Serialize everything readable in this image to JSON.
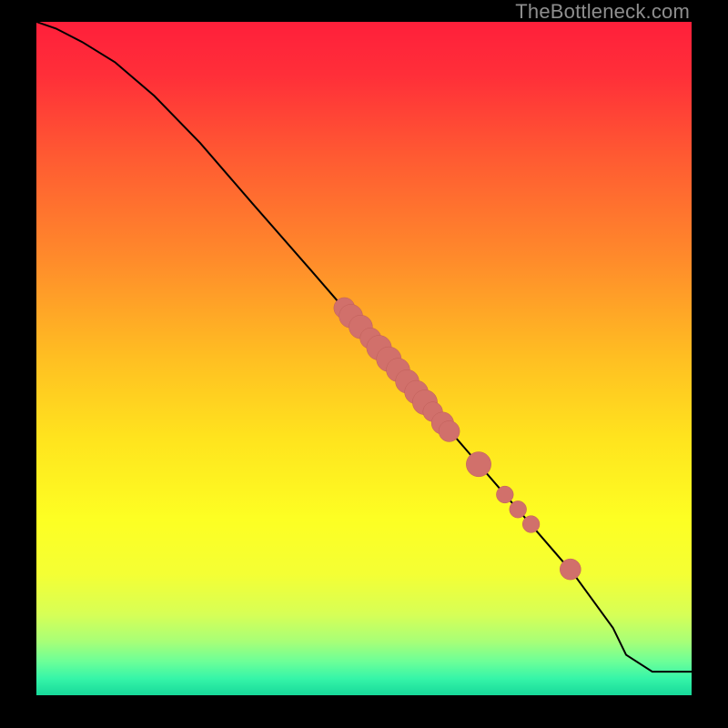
{
  "watermark": "TheBottleneck.com",
  "gradient": {
    "stops": [
      {
        "offset": 0.0,
        "color": "#ff1f3a"
      },
      {
        "offset": 0.08,
        "color": "#ff2f39"
      },
      {
        "offset": 0.2,
        "color": "#ff5a32"
      },
      {
        "offset": 0.35,
        "color": "#ff8a2b"
      },
      {
        "offset": 0.5,
        "color": "#ffbf22"
      },
      {
        "offset": 0.62,
        "color": "#ffe41e"
      },
      {
        "offset": 0.74,
        "color": "#fdff23"
      },
      {
        "offset": 0.82,
        "color": "#f4ff34"
      },
      {
        "offset": 0.88,
        "color": "#d7ff56"
      },
      {
        "offset": 0.92,
        "color": "#a8ff77"
      },
      {
        "offset": 0.95,
        "color": "#6cff98"
      },
      {
        "offset": 0.975,
        "color": "#36f5a8"
      },
      {
        "offset": 1.0,
        "color": "#17d99a"
      }
    ]
  },
  "colors": {
    "line": "#000000",
    "marker_fill": "#d1706b",
    "marker_stroke": "#c05e59"
  },
  "chart_data": {
    "type": "line",
    "title": "",
    "xlabel": "",
    "ylabel": "",
    "xlim": [
      0,
      100
    ],
    "ylim": [
      0,
      100
    ],
    "series": [
      {
        "name": "curve",
        "x": [
          0,
          3,
          7,
          12,
          18,
          25,
          33,
          42,
          50,
          58,
          66,
          74,
          82,
          88,
          90,
          94,
          100
        ],
        "y": [
          100,
          99,
          97,
          94,
          89,
          82,
          73,
          63,
          54,
          45,
          36,
          27,
          18,
          10,
          6,
          3.5,
          3.5
        ]
      }
    ],
    "markers": [
      {
        "x": 47,
        "y": 57.5,
        "r": 1.6
      },
      {
        "x": 48,
        "y": 56.3,
        "r": 1.8
      },
      {
        "x": 49.5,
        "y": 54.7,
        "r": 1.8
      },
      {
        "x": 51,
        "y": 53.0,
        "r": 1.6
      },
      {
        "x": 52.3,
        "y": 51.6,
        "r": 1.9
      },
      {
        "x": 53.8,
        "y": 49.9,
        "r": 1.9
      },
      {
        "x": 55.2,
        "y": 48.3,
        "r": 1.8
      },
      {
        "x": 56.6,
        "y": 46.6,
        "r": 1.8
      },
      {
        "x": 58.0,
        "y": 45.0,
        "r": 1.8
      },
      {
        "x": 59.3,
        "y": 43.5,
        "r": 1.9
      },
      {
        "x": 60.5,
        "y": 42.1,
        "r": 1.5
      },
      {
        "x": 62.0,
        "y": 40.4,
        "r": 1.7
      },
      {
        "x": 63.0,
        "y": 39.2,
        "r": 1.6
      },
      {
        "x": 67.5,
        "y": 34.3,
        "r": 1.9
      },
      {
        "x": 71.5,
        "y": 29.8,
        "r": 1.3
      },
      {
        "x": 73.5,
        "y": 27.6,
        "r": 1.3
      },
      {
        "x": 75.5,
        "y": 25.4,
        "r": 1.3
      },
      {
        "x": 81.5,
        "y": 18.7,
        "r": 1.6
      }
    ]
  }
}
